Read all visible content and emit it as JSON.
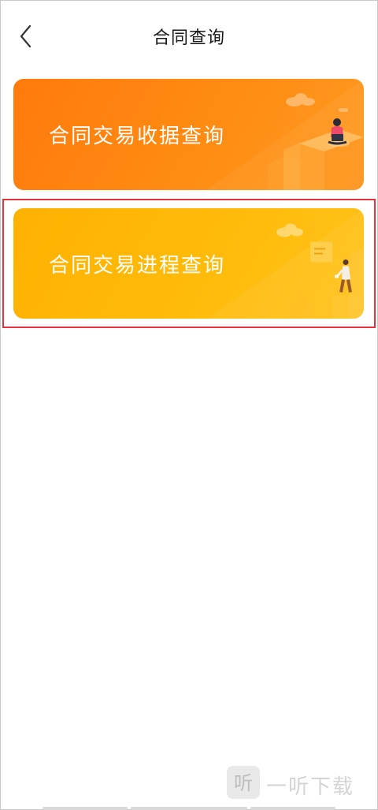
{
  "header": {
    "title": "合同查询",
    "back_icon": "chevron-left-icon"
  },
  "cards": [
    {
      "label": "合同交易收据查询",
      "color": "#ff7f10"
    },
    {
      "label": "合同交易进程查询",
      "color": "#ffb700"
    }
  ],
  "watermark": {
    "logo_text": "听",
    "text": "一听下载"
  },
  "colors": {
    "highlight": "#e5323c"
  }
}
